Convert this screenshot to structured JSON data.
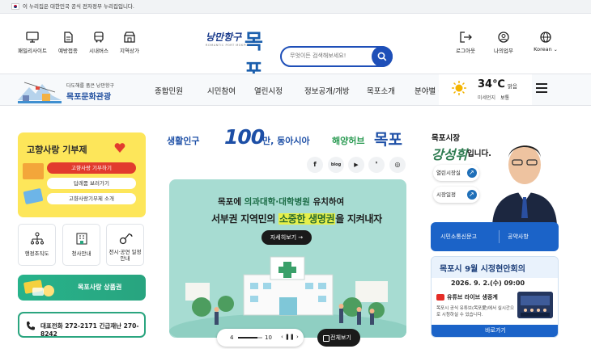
{
  "gov_banner": {
    "text": "이 누리집은 대한민국 공식 전자정부 누리집입니다."
  },
  "quick_links": [
    {
      "label": "패밀리사이트",
      "icon": "monitor-icon"
    },
    {
      "label": "예방접종",
      "icon": "document-icon"
    },
    {
      "label": "시내버스",
      "icon": "bus-icon"
    },
    {
      "label": "지역상가",
      "icon": "store-icon"
    }
  ],
  "logo": {
    "romantic": "낭만항구",
    "name": "목포",
    "sub": "ROMANTIC PORT MOKPO"
  },
  "search": {
    "placeholder": "무엇이든 검색해보세요!"
  },
  "right_links": [
    {
      "label": "로그아웃",
      "icon": "logout-icon"
    },
    {
      "label": "나의업무",
      "icon": "user-icon"
    },
    {
      "label": "Korean",
      "icon": "globe-icon"
    }
  ],
  "tour": {
    "line1": "다도해를 품은 낭만항구",
    "line2": "목포문화관광"
  },
  "menu": [
    "종합민원",
    "시민참여",
    "열린시정",
    "정보공개/개방",
    "목포소개",
    "분야별 정보"
  ],
  "weather": {
    "temp": "34℃",
    "cond": "맑음",
    "dust_label": "미세먼지",
    "dust_val": "보통"
  },
  "gift": {
    "title": "고향사랑 기부제",
    "buttons": [
      "고향사랑 기부하기",
      "답례품 보러가기",
      "고향사랑기부제 소개"
    ]
  },
  "services": [
    "행정조직도",
    "청사안내",
    "전시·공연 일정안내"
  ],
  "goods": {
    "label": "목포사랑 상품권"
  },
  "tel": {
    "text": "대표전화 272-2171 긴급재난 270-8242"
  },
  "slogan": {
    "a": "생활인구",
    "b": "100",
    "c": "만, 동아시아",
    "d": "해양허브",
    "e": "목포"
  },
  "sns": [
    "f",
    "blog",
    "▶",
    "❜",
    "◎"
  ],
  "banner": {
    "line1_a": "목포에 ",
    "line1_b": "의과대학·대학병원",
    "line1_c": " 유치하여",
    "line2_a": "서부권 지역민의 ",
    "line2_b": "소중한 생명권",
    "line2_c": "을 지켜내자",
    "more": "자세히보기 →"
  },
  "pager": {
    "current": "4",
    "total": "10",
    "pause": "‹ ❚❚ ›"
  },
  "view_all": "전체보기",
  "mayor": {
    "title": "목포시장",
    "name": "강성휘",
    "suffix": "입니다.",
    "buttons": [
      "열린시장실",
      "시장일정"
    ]
  },
  "bluebar": {
    "a": "시민소통신문고",
    "b": "공약사항"
  },
  "live": {
    "title": "목포시 9월 시정현안회의",
    "date": "2026. 9. 2.(수) 09:00",
    "live_label": "유튜브 라이브 생중계",
    "desc": "목포시 공식 유튜브(목포愛)에서 실시간으로 시청하실 수 있습니다.",
    "go": "바로가기"
  }
}
